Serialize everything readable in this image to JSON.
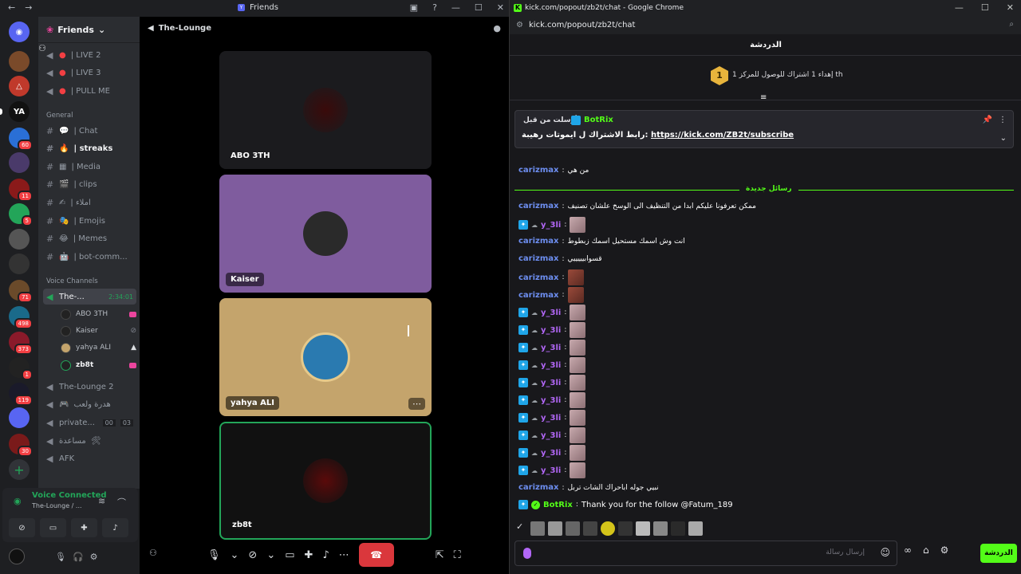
{
  "discord": {
    "title": "Friends",
    "header": {
      "label": "Friends"
    },
    "voice_stage_title": "The-Lounge",
    "channels": [
      {
        "label": "| LIVE 2"
      },
      {
        "label": "| LIVE 3"
      },
      {
        "label": "| PULL ME"
      },
      {
        "label": "General"
      },
      {
        "label": "| Chat"
      },
      {
        "label": "| streaks"
      },
      {
        "label": "| Media"
      },
      {
        "label": "| clips"
      },
      {
        "label": "| املاء"
      },
      {
        "label": "| Emojis"
      },
      {
        "label": "| Memes"
      },
      {
        "label": "| bot-comm..."
      },
      {
        "label": "Voice Channels"
      },
      {
        "label": "The-...",
        "timer": "2:34:01"
      },
      {
        "label": "The-Lounge 2"
      },
      {
        "label": "هدرة ولعب"
      },
      {
        "label": "private...",
        "count_a": "00",
        "count_b": "03"
      },
      {
        "label": "مساعدة"
      },
      {
        "label": "AFK"
      }
    ],
    "voice_users": [
      {
        "name": "ABO 3TH"
      },
      {
        "name": "Kaiser"
      },
      {
        "name": "yahya ALI"
      },
      {
        "name": "zb8t"
      }
    ],
    "server_badges": [
      "60",
      "11",
      "5",
      "71",
      "498",
      "373",
      "1",
      "119",
      "30"
    ],
    "voice_panel": {
      "status": "Voice Connected",
      "sub": "The-Lounge / ..."
    },
    "tiles": [
      {
        "name": "ABO 3TH"
      },
      {
        "name": "Kaiser"
      },
      {
        "name": "yahya ALI"
      },
      {
        "name": "zb8t"
      }
    ]
  },
  "chrome": {
    "title": "kick.com/popout/zb2t/chat - Google Chrome",
    "url": "kick.com/popout/zb2t/chat",
    "chat_title": "الدردشة",
    "goal": {
      "level": "1",
      "text": "إهداء 1 اشتراك للوصول للمركز 1 th"
    },
    "pinned": {
      "by": "أرسلت من قبل",
      "bot": "BotRix",
      "prefix": "رابط الاشتراك ل ايموتات رهيبة:",
      "link": "https://kick.com/ZB2t/subscribe"
    },
    "new_messages": "رسائل جديدة",
    "messages": [
      {
        "user": "carizmax",
        "text": "من هي"
      },
      {
        "user": "carizmax",
        "text": "ممكن تعرفونا عليكم ابدا من التنظيف الى الوسخ علشان تصنيف"
      },
      {
        "user": "y_3li",
        "text": ""
      },
      {
        "user": "carizmax",
        "text": "انت وش اسمك مستحيل اسمك زبطوط"
      },
      {
        "user": "carizmax",
        "text": "قسوابيييييي"
      },
      {
        "user": "carizmax",
        "text": ""
      },
      {
        "user": "carizmax",
        "text": ""
      },
      {
        "user": "y_3li",
        "text": ""
      },
      {
        "user": "y_3li",
        "text": ""
      },
      {
        "user": "y_3li",
        "text": ""
      },
      {
        "user": "y_3li",
        "text": ""
      },
      {
        "user": "y_3li",
        "text": ""
      },
      {
        "user": "y_3li",
        "text": ""
      },
      {
        "user": "y_3li",
        "text": ""
      },
      {
        "user": "y_3li",
        "text": ""
      },
      {
        "user": "y_3li",
        "text": ""
      },
      {
        "user": "y_3li",
        "text": ""
      },
      {
        "user": "carizmax",
        "text": "نبيي جوله اباحراك الشات تربل"
      },
      {
        "user": "BotRix",
        "text": "Thank you for the follow @Fatum_189"
      }
    ],
    "input_placeholder": "إرسال رسالة",
    "send_label": "الدردشة"
  },
  "colors": {
    "kick_green": "#53fc18",
    "discord_bg": "#1e1f22",
    "end_call": "#da373c"
  }
}
